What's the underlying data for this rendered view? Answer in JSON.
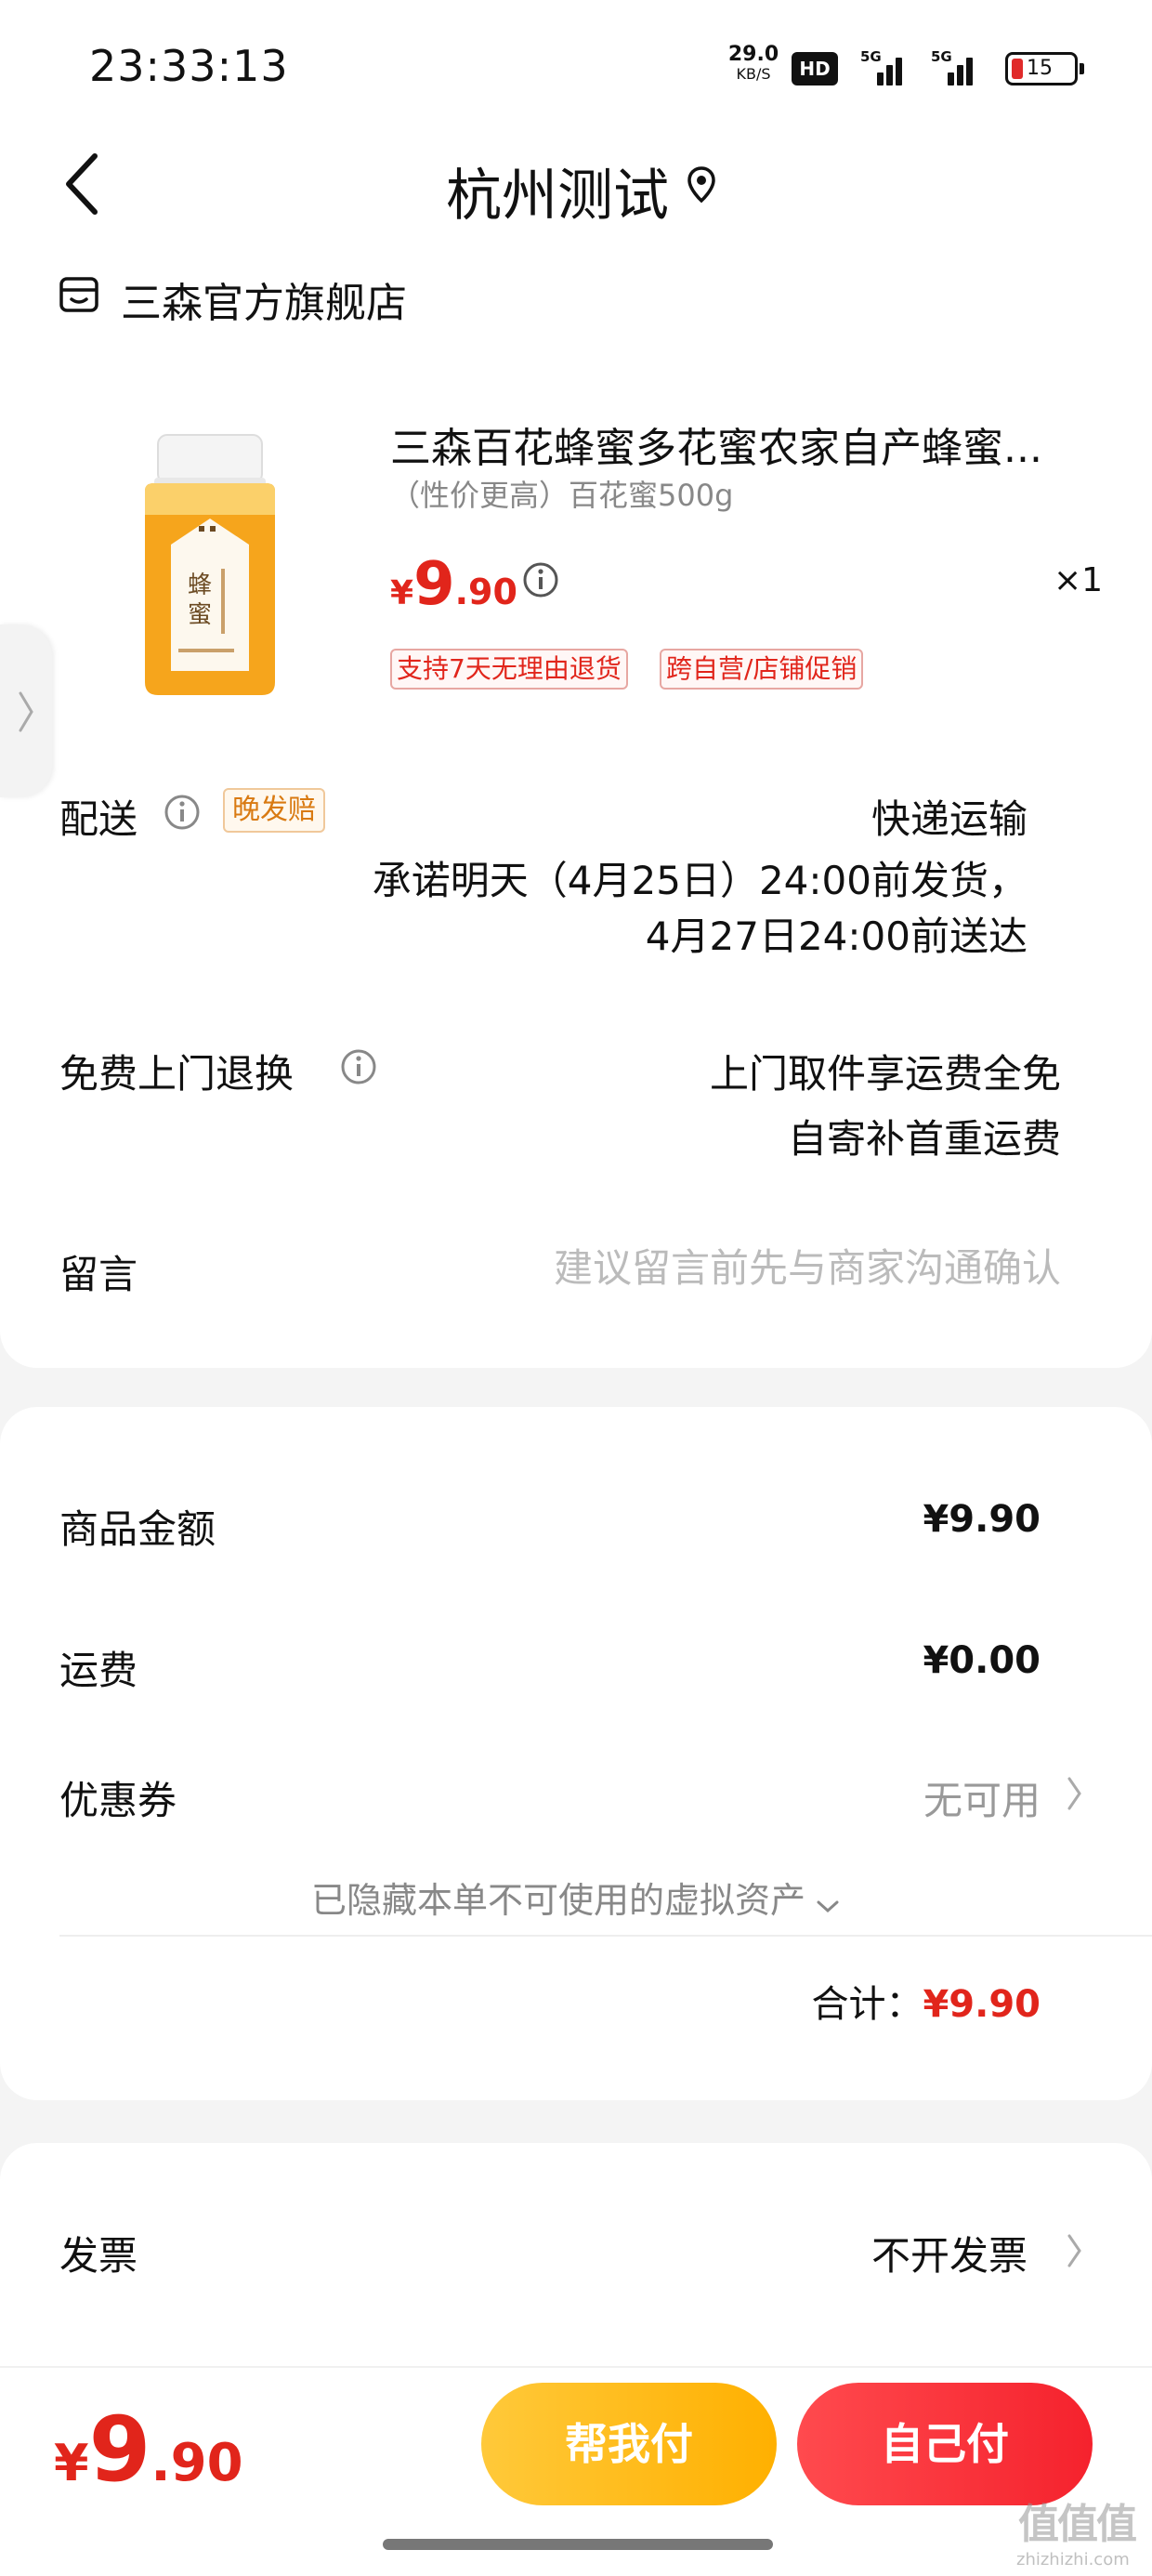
{
  "status_bar": {
    "time": "23:33:13",
    "net_speed": "29.0",
    "net_unit": "KB/S",
    "hd_label": "HD",
    "signal1_label": "5G",
    "signal2_label": "5G",
    "battery_level": "15"
  },
  "header": {
    "title": "杭州测试",
    "back_icon": "chevron-left-icon",
    "location_icon": "map-pin-icon"
  },
  "store": {
    "name": "三森官方旗舰店",
    "icon": "store-icon"
  },
  "product": {
    "title": "三森百花蜂蜜多花蜜农家自产蜂蜜...",
    "spec": "（性价更高）百花蜜500g",
    "price_symbol": "¥",
    "price_integer": "9",
    "price_decimal": ".90",
    "quantity": "×1",
    "tags": [
      "支持7天无理由退货",
      "跨自营/店铺促销"
    ]
  },
  "delivery": {
    "label": "配送",
    "badge": "晚发赔",
    "method": "快递运输",
    "promise_line1": "承诺明天（4月25日）24:00前发货，",
    "promise_line2": "4月27日24:00前送达"
  },
  "returns": {
    "label": "免费上门退换",
    "line1": "上门取件享运费全免",
    "line2": "自寄补首重运费"
  },
  "message": {
    "label": "留言",
    "placeholder": "建议留言前先与商家沟通确认"
  },
  "amounts": {
    "goods_label": "商品金额",
    "goods_value": "¥9.90",
    "shipping_label": "运费",
    "shipping_value": "¥0.00",
    "coupon_label": "优惠券",
    "coupon_value": "无可用",
    "hidden_assets": "已隐藏本单不可使用的虚拟资产",
    "total_label": "合计：",
    "total_value": "¥9.90"
  },
  "invoice": {
    "label": "发票",
    "value": "不开发票"
  },
  "bottom_bar": {
    "price_symbol": "¥",
    "price_integer": "9",
    "price_decimal": ".90",
    "help_pay_label": "帮我付",
    "self_pay_label": "自己付"
  },
  "watermark": {
    "logo": "值值值",
    "text": "zhizhizhi.com"
  },
  "colors": {
    "accent_red": "#e1251b",
    "help_pay_yellow": "#ffb000",
    "self_pay_red": "#f5222d",
    "badge_orange": "#d97a12"
  }
}
